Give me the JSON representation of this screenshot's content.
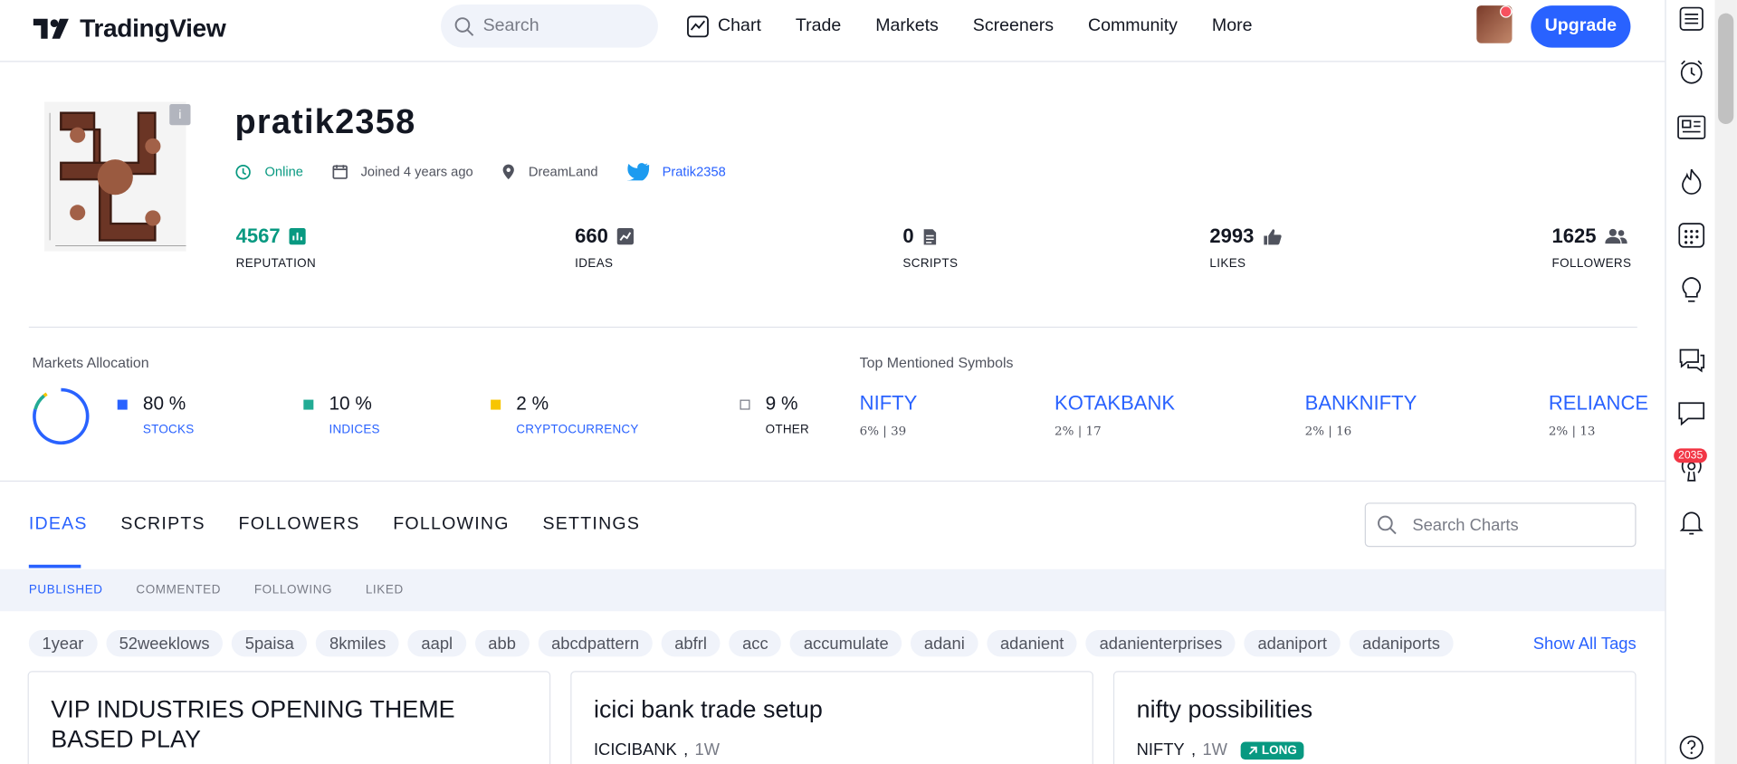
{
  "header": {
    "logo": "TradingView",
    "search_placeholder": "Search",
    "nav": [
      "Chart",
      "Trade",
      "Markets",
      "Screeners",
      "Community",
      "More"
    ],
    "upgrade_label": "Upgrade"
  },
  "profile": {
    "username": "pratik2358",
    "status": "Online",
    "joined": "Joined 4 years ago",
    "location": "DreamLand",
    "twitter": "Pratik2358",
    "stats": [
      {
        "value": "4567",
        "label": "REPUTATION",
        "icon": "chart-bar-icon"
      },
      {
        "value": "660",
        "label": "IDEAS",
        "icon": "chart-line-icon"
      },
      {
        "value": "0",
        "label": "SCRIPTS",
        "icon": "document-icon"
      },
      {
        "value": "2993",
        "label": "LIKES",
        "icon": "thumbs-up-icon"
      },
      {
        "value": "1625",
        "label": "FOLLOWERS",
        "icon": "people-icon"
      }
    ]
  },
  "markets_allocation": {
    "title": "Markets Allocation",
    "items": [
      {
        "value": "80 %",
        "label": "STOCKS",
        "color": "#2962ff",
        "fraction": 0.8
      },
      {
        "value": "10 %",
        "label": "INDICES",
        "color": "#22ab94",
        "fraction": 0.1
      },
      {
        "value": "2 %",
        "label": "CRYPTOCURRENCY",
        "color": "#f7c500",
        "fraction": 0.02
      },
      {
        "value": "9 %",
        "label": "OTHER",
        "color": "#ffffff",
        "fraction": 0.09
      }
    ]
  },
  "top_symbols": {
    "title": "Top Mentioned Symbols",
    "items": [
      {
        "name": "NIFTY",
        "sub": "6% | 39"
      },
      {
        "name": "KOTAKBANK",
        "sub": "2% | 17"
      },
      {
        "name": "BANKNIFTY",
        "sub": "2% | 16"
      },
      {
        "name": "RELIANCE",
        "sub": "2% | 13"
      }
    ]
  },
  "tabs": [
    "IDEAS",
    "SCRIPTS",
    "FOLLOWERS",
    "FOLLOWING",
    "SETTINGS"
  ],
  "search_charts_placeholder": "Search Charts",
  "subtabs": [
    "PUBLISHED",
    "COMMENTED",
    "FOLLOWING",
    "LIKED"
  ],
  "tags": [
    "1year",
    "52weeklows",
    "5paisa",
    "8kmiles",
    "aapl",
    "abb",
    "abcdpattern",
    "abfrl",
    "acc",
    "accumulate",
    "adani",
    "adanient",
    "adanienterprises",
    "adaniport",
    "adaniports"
  ],
  "show_all_tags": "Show All Tags",
  "sidebar_badge": "2035",
  "cards": [
    {
      "title": "VIP INDUSTRIES OPENING THEME BASED PLAY",
      "symbol": "",
      "timeframe": "",
      "badge": ""
    },
    {
      "title": "icici bank trade setup",
      "symbol": "ICICIBANK",
      "timeframe": "1W",
      "badge": ""
    },
    {
      "title": "nifty possibilities",
      "symbol": "NIFTY",
      "timeframe": "1W",
      "badge": "LONG"
    }
  ]
}
